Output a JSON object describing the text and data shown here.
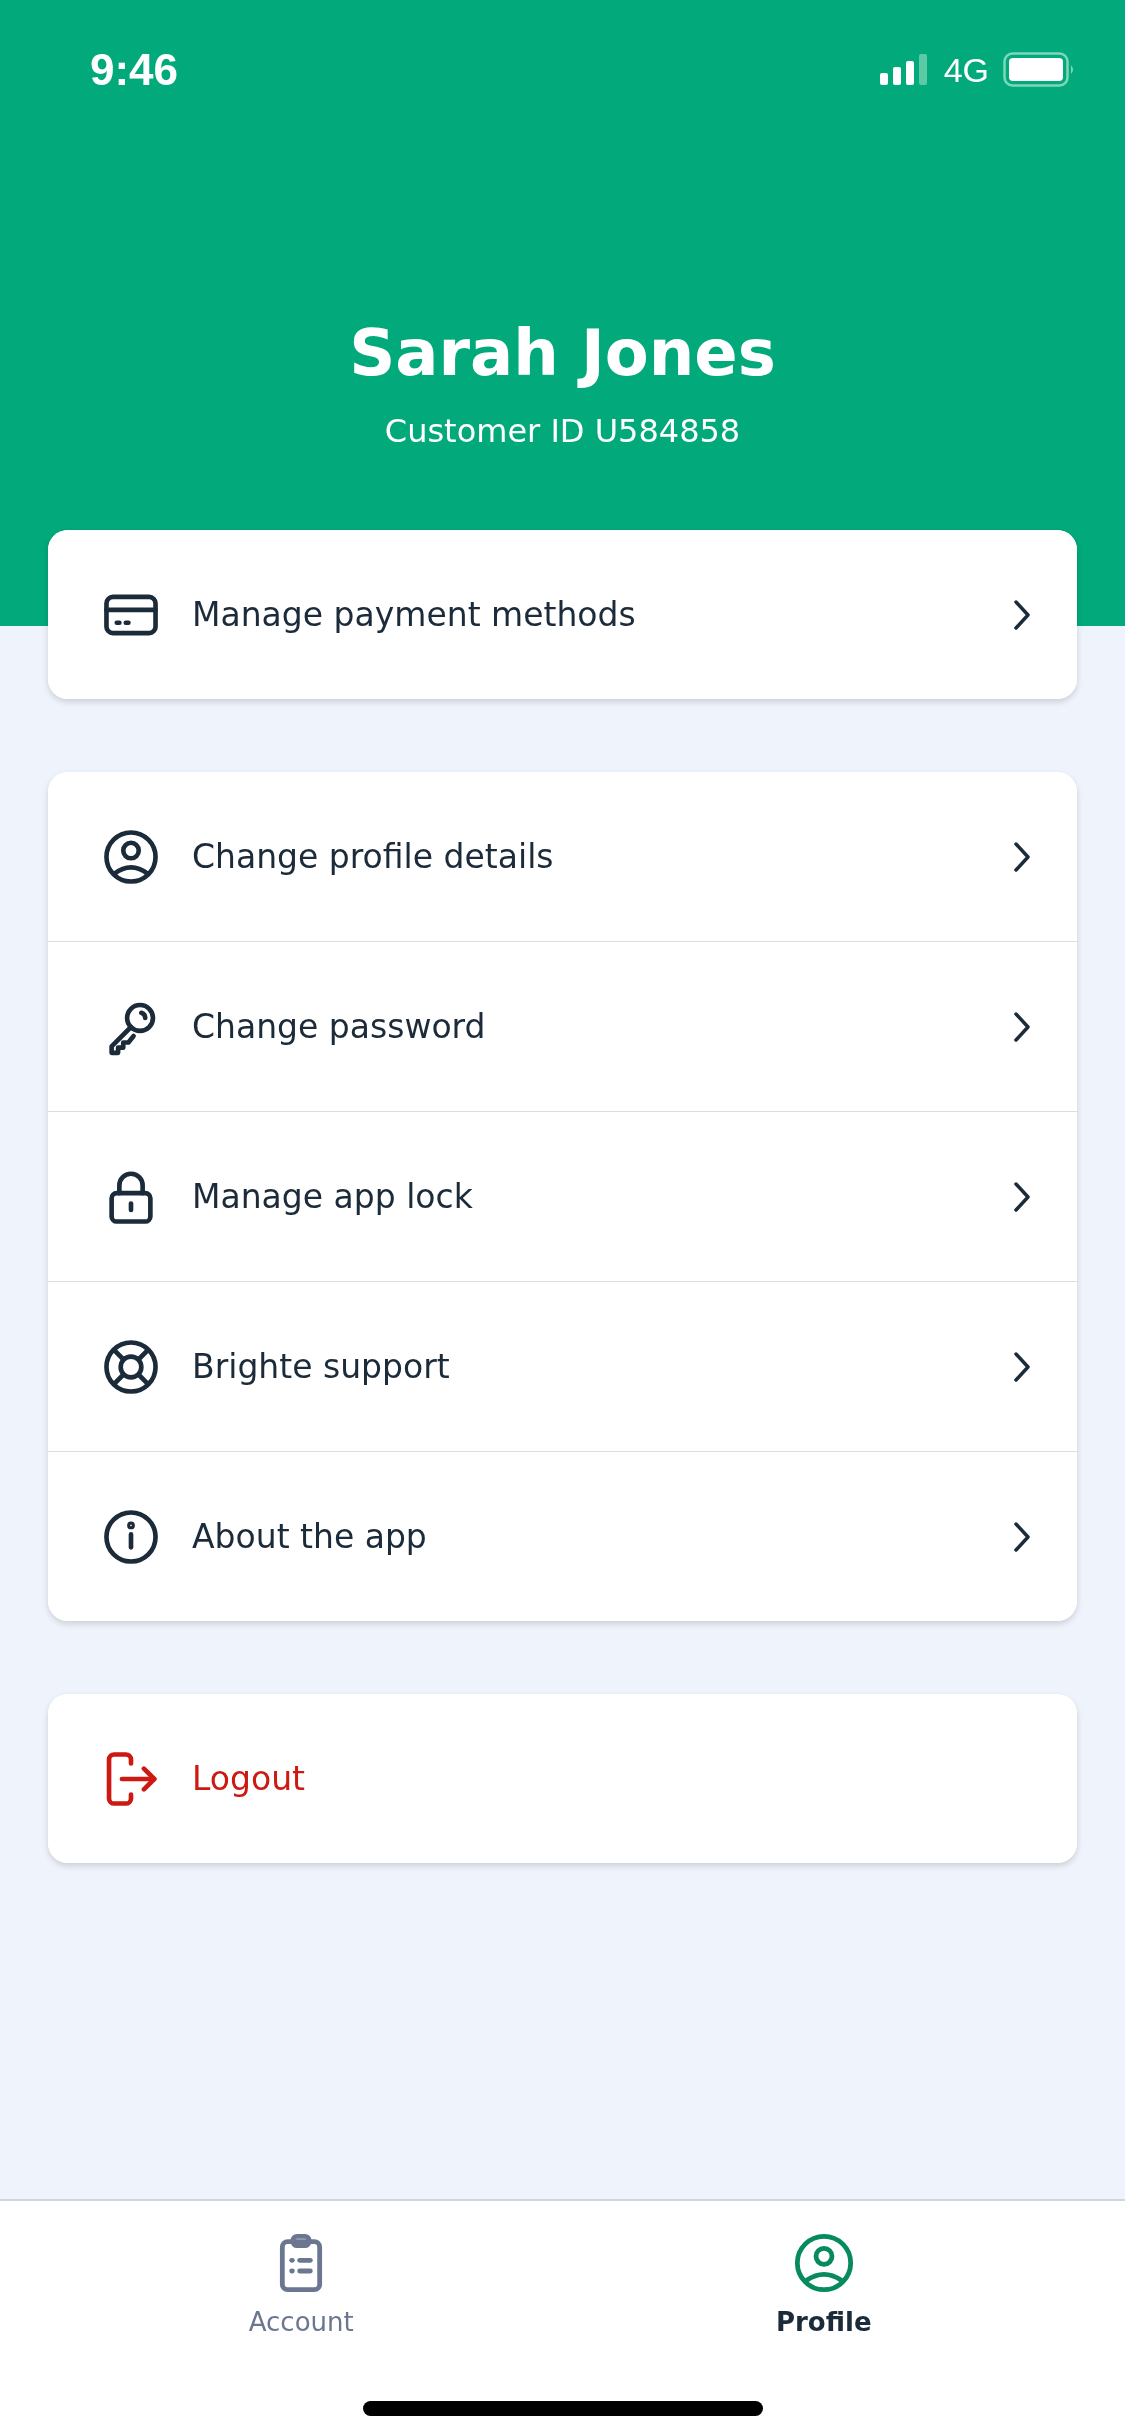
{
  "status_bar": {
    "time": "9:46",
    "network": "4G"
  },
  "header": {
    "name": "Sarah Jones",
    "customer_id": "Customer ID U584858"
  },
  "groups": [
    {
      "items": [
        {
          "label": "Manage payment methods",
          "kind": "link"
        }
      ]
    },
    {
      "items": [
        {
          "label": "Change profile details",
          "kind": "link"
        },
        {
          "label": "Change password",
          "kind": "link"
        },
        {
          "label": "Manage app lock",
          "kind": "link"
        },
        {
          "label": "Brighte support",
          "kind": "link"
        },
        {
          "label": "About the app",
          "kind": "link"
        }
      ]
    },
    {
      "items": [
        {
          "label": "Logout",
          "kind": "danger"
        }
      ]
    }
  ],
  "tabs": [
    {
      "label": "Account",
      "selected": false
    },
    {
      "label": "Profile",
      "selected": true
    }
  ]
}
